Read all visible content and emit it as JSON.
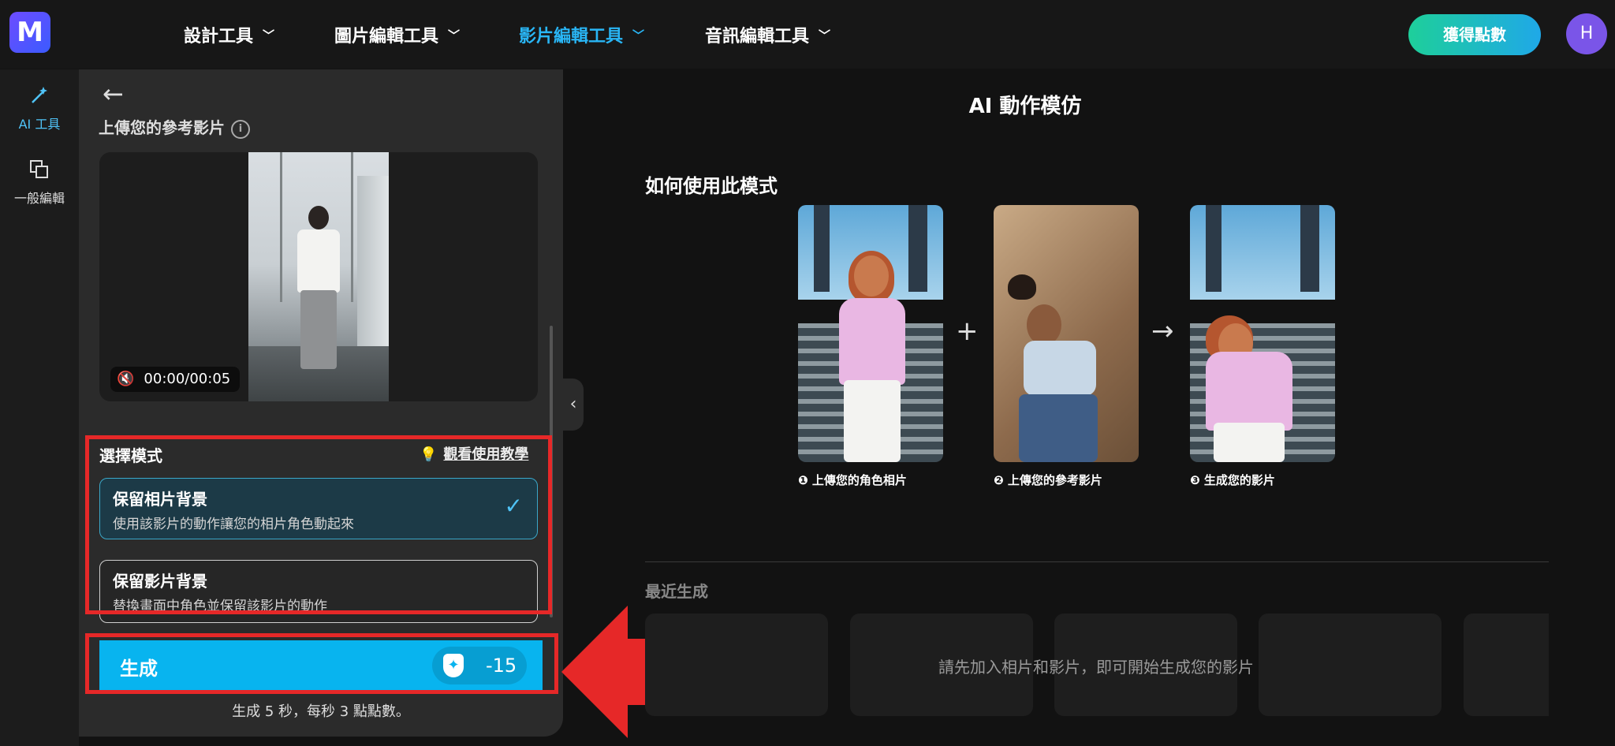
{
  "brand": {
    "logo_text": "M"
  },
  "nav": {
    "items": [
      {
        "label": "設計工具",
        "active": false
      },
      {
        "label": "圖片編輯工具",
        "active": false
      },
      {
        "label": "影片編輯工具",
        "active": true
      },
      {
        "label": "音訊編輯工具",
        "active": false
      }
    ],
    "get_points_label": "獲得點數",
    "avatar_initial": "H"
  },
  "sidebar": {
    "items": [
      {
        "label": "AI 工具",
        "icon": "magic-wand-icon",
        "active": true
      },
      {
        "label": "一般編輯",
        "icon": "layers-icon",
        "active": false
      }
    ]
  },
  "panel": {
    "upload_title": "上傳您的參考影片",
    "video_time": "00:00/00:05",
    "mode_heading": "選擇模式",
    "tutorial_label": "觀看使用教學",
    "modes": [
      {
        "title": "保留相片背景",
        "desc": "使用該影片的動作讓您的相片角色動起來",
        "selected": true
      },
      {
        "title": "保留影片背景",
        "desc": "替換畫面中角色並保留該影片的動作",
        "selected": false
      }
    ],
    "generate_label": "生成",
    "generate_cost": "-15",
    "generate_note": "生成 5 秒，每秒 3 點點數。"
  },
  "main": {
    "title": "AI 動作模仿",
    "howto_heading": "如何使用此模式",
    "steps": [
      {
        "caption": "❶ 上傳您的角色相片"
      },
      {
        "caption": "❷ 上傳您的參考影片"
      },
      {
        "caption": "❸ 生成您的影片"
      }
    ],
    "plus_symbol": "+",
    "arrow_symbol": "→",
    "recent_heading": "最近生成",
    "empty_message": "請先加入相片和影片，即可開始生成您的影片"
  },
  "colors": {
    "accent": "#08b4ef",
    "active_nav": "#29b6f6",
    "annotation_red": "#e62828",
    "get_points_gradient": [
      "#1ecf9a",
      "#1fa8e8"
    ]
  }
}
